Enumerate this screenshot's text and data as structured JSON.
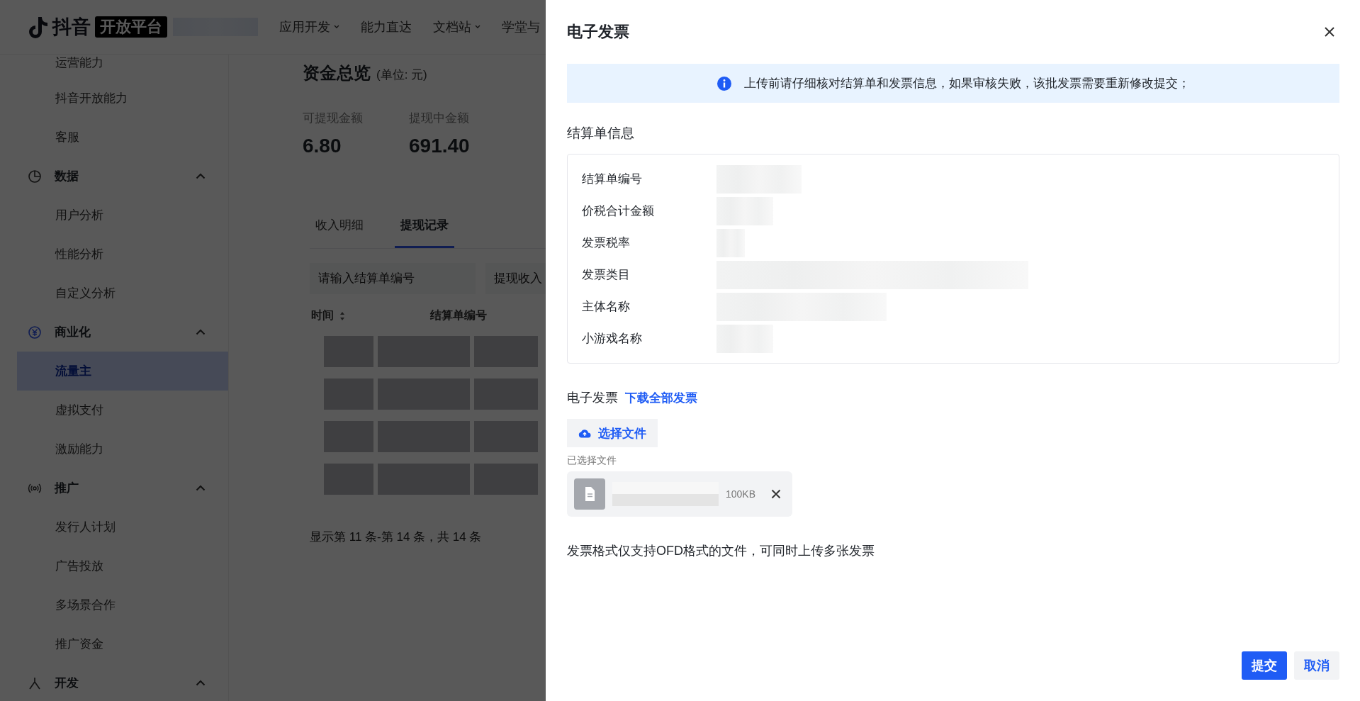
{
  "header": {
    "logo_text": "抖音",
    "logo_badge": "开放平台",
    "nav": [
      {
        "label": "应用开发",
        "has_menu": true
      },
      {
        "label": "能力直达",
        "has_menu": false
      },
      {
        "label": "文档站",
        "has_menu": true
      },
      {
        "label": "学堂与",
        "has_menu": false
      }
    ]
  },
  "sidebar": {
    "items": [
      {
        "kind": "item",
        "label": "运营能力",
        "selected": false
      },
      {
        "kind": "item",
        "label": "抖音开放能力",
        "selected": false
      },
      {
        "kind": "item",
        "label": "客服",
        "selected": false
      },
      {
        "kind": "group",
        "label": "数据",
        "expanded": true,
        "children": [
          {
            "label": "用户分析",
            "selected": false
          },
          {
            "label": "性能分析",
            "selected": false
          },
          {
            "label": "自定义分析",
            "selected": false
          }
        ]
      },
      {
        "kind": "group",
        "label": "商业化",
        "expanded": true,
        "children": [
          {
            "label": "流量主",
            "selected": true
          },
          {
            "label": "虚拟支付",
            "selected": false
          },
          {
            "label": "激励能力",
            "selected": false
          }
        ]
      },
      {
        "kind": "group",
        "label": "推广",
        "expanded": true,
        "children": [
          {
            "label": "发行人计划",
            "selected": false
          },
          {
            "label": "广告投放",
            "selected": false
          },
          {
            "label": "多场景合作",
            "selected": false
          },
          {
            "label": "推广资金",
            "selected": false
          }
        ]
      },
      {
        "kind": "group",
        "label": "开发",
        "expanded": true
      }
    ]
  },
  "overview": {
    "title": "资金总览",
    "unit": "(单位: 元)",
    "stats": [
      {
        "label": "可提现金额",
        "value": "6.80"
      },
      {
        "label": "提现中金额",
        "value": "691.40"
      }
    ]
  },
  "tabs": [
    {
      "label": "收入明细",
      "selected": false
    },
    {
      "label": "提现记录",
      "selected": true
    }
  ],
  "filters": [
    {
      "placeholder": "请输入结算单编号"
    },
    {
      "placeholder": "提现收入"
    }
  ],
  "table": {
    "columns": [
      {
        "label": "时间",
        "sortable": true
      },
      {
        "label": "结算单编号",
        "sortable": false
      }
    ]
  },
  "pagination": "显示第 11 条-第 14 条，共 14 条",
  "drawer": {
    "title": "电子发票",
    "alert": "上传前请仔细核对结算单和发票信息，如果审核失败，该批发票需要重新修改提交；",
    "section_title": "结算单信息",
    "fields": [
      {
        "label": "结算单编号"
      },
      {
        "label": "价税合计金额"
      },
      {
        "label": "发票税率"
      },
      {
        "label": "发票类目"
      },
      {
        "label": "主体名称"
      },
      {
        "label": "小游戏名称"
      }
    ],
    "invoice_label": "电子发票",
    "download_link": "下载全部发票",
    "upload_button": "选择文件",
    "selected_label": "已选择文件",
    "files": [
      {
        "size": "100KB"
      }
    ],
    "note": "发票格式仅支持OFD格式的文件，可同时上传多张发票",
    "buttons": [
      {
        "label": "提交",
        "kind": "primary"
      },
      {
        "label": "取消",
        "kind": "secondary"
      }
    ]
  }
}
